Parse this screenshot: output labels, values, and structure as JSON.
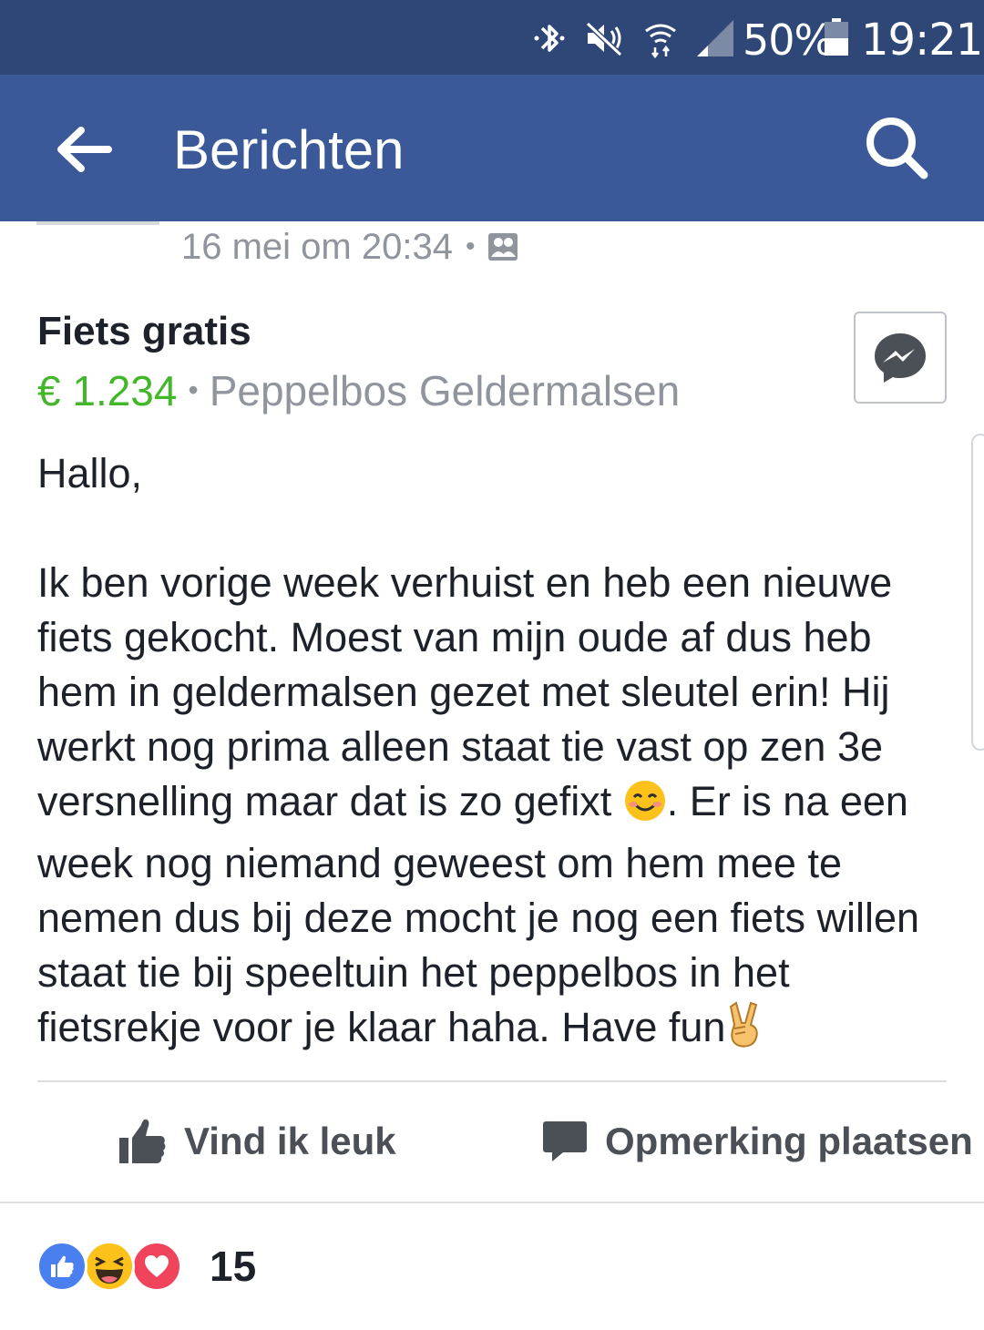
{
  "status_bar": {
    "battery_percent": "50%",
    "time": "19:21",
    "icons": [
      "bluetooth-icon",
      "mute-icon",
      "wifi-icon",
      "signal-icon",
      "battery-icon"
    ]
  },
  "app_bar": {
    "title": "Berichten",
    "back_icon": "arrow-left-icon",
    "search_icon": "search-icon"
  },
  "post": {
    "timestamp": "16 mei om 20:34",
    "meta_separator": "•",
    "audience_icon": "group-icon",
    "listing": {
      "title": "Fiets gratis",
      "price": "€ 1.234",
      "separator": "•",
      "location": "Peppelbos Geldermalsen"
    },
    "body": {
      "greeting": "Hallo,",
      "text_before_emoji": "Ik ben vorige week verhuist en heb een nieuwe fiets gekocht. Moest van mijn oude af dus heb hem in geldermalsen gezet met sleutel erin! Hij werkt nog prima alleen staat tie vast op zen 3e versnelling maar dat is zo gefixt ",
      "emoji_1": "smiling-face-emoji",
      "text_after_emoji": ". Er is na een week nog niemand geweest om hem mee te nemen dus bij deze mocht je nog een fiets willen staat tie bij speeltuin het peppelbos in het fietsrekje voor je klaar haha. Have fun",
      "emoji_2": "victory-hand-emoji"
    }
  },
  "actions": {
    "like_label": "Vind ik leuk",
    "comment_label": "Opmerking plaatsen"
  },
  "reactions": {
    "types": [
      "like",
      "haha",
      "love"
    ],
    "count": "15"
  },
  "colors": {
    "status_bar": "#2f4777",
    "app_bar": "#3b5998",
    "price_green": "#42b72a",
    "meta_gray": "#90949c",
    "action_gray": "#4b4f56"
  }
}
